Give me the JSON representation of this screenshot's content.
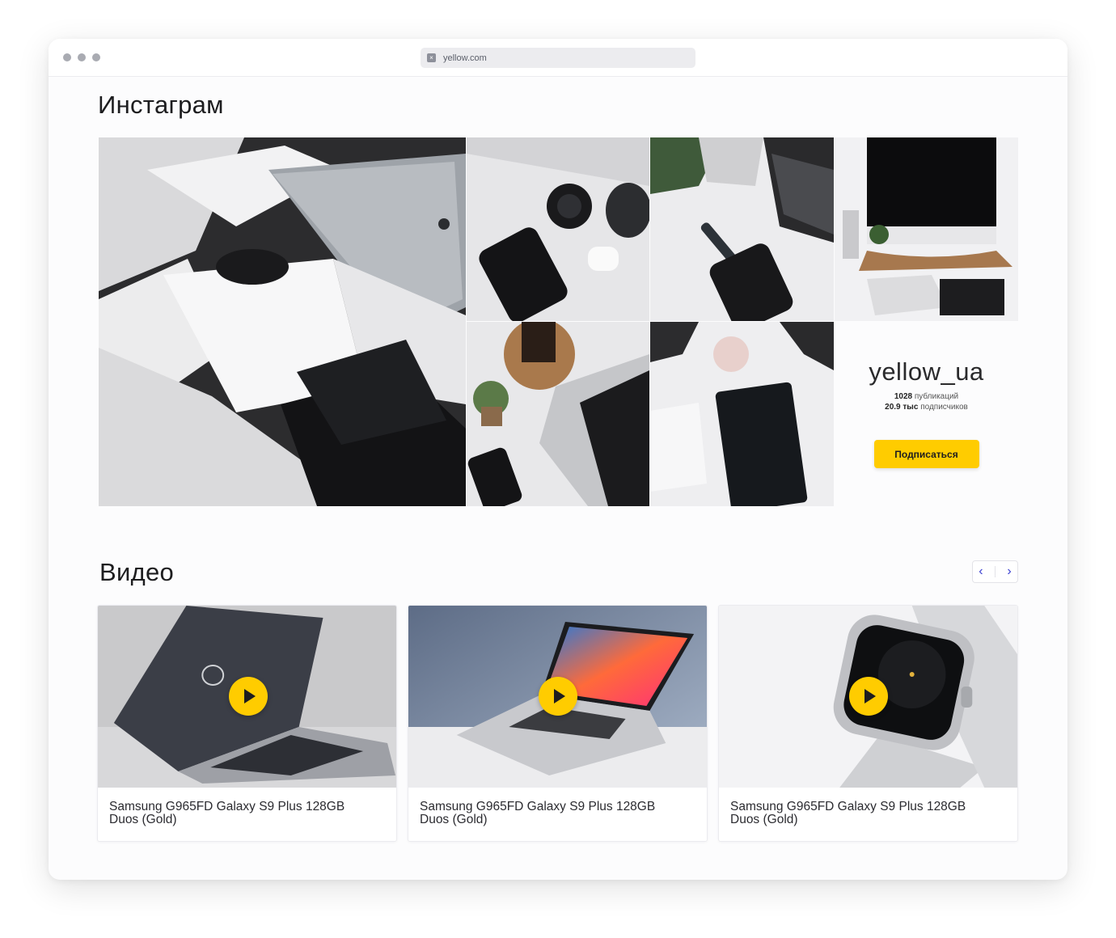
{
  "browser": {
    "url": "yellow.com"
  },
  "instagram": {
    "title": "Инстаграм",
    "handle": "yellow_ua",
    "posts_count": "1028",
    "posts_label": "публикаций",
    "followers_count": "20.9 тыс",
    "followers_label": "подписчиков",
    "subscribe_label": "Подписаться",
    "photos": [
      "macbook-and-boxes-photo",
      "phone-camera-lens-airpods-photo",
      "iphone-watch-laptop-photo",
      "imac-desk-photo",
      "laptop-coffee-succulent-photo",
      "keyboard-wallet-photo"
    ]
  },
  "videos": {
    "title": "Видео",
    "items": [
      {
        "title": "Samsung G965FD Galaxy S9 Plus 128GB Duos (Gold)",
        "thumb": "dell-laptop"
      },
      {
        "title": "Samsung G965FD Galaxy S9 Plus 128GB Duos (Gold)",
        "thumb": "macbook-pro"
      },
      {
        "title": "Samsung G965FD Galaxy S9 Plus 128GB Duos (Gold)",
        "thumb": "apple-watch"
      }
    ]
  },
  "colors": {
    "accent": "#ffcc00",
    "arrow": "#3a3fd1",
    "text": "#1d1d1f"
  }
}
